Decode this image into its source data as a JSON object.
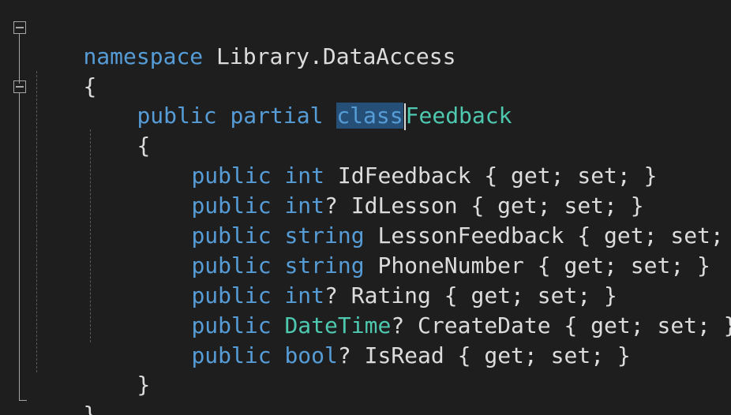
{
  "editor": {
    "language": "csharp",
    "highlighted_token": "class",
    "theme_colors": {
      "background": "#1e1e1e",
      "keyword": "#569cd6",
      "type": "#4ec9b0",
      "identifier": "#dcdcdc",
      "selection": "#264f78"
    },
    "code": {
      "namespace_kw": "namespace",
      "namespace_name": "Library.DataAccess",
      "open_brace": "{",
      "close_brace": "}",
      "class_decl": {
        "public": "public",
        "partial": "partial",
        "class": "class",
        "name": "Feedback"
      },
      "properties": [
        {
          "access": "public",
          "type": "int",
          "type_kind": "keyword",
          "nullable": "",
          "name": "IdFeedback",
          "accessors": "{ get; set; }"
        },
        {
          "access": "public",
          "type": "int",
          "type_kind": "keyword",
          "nullable": "?",
          "name": "IdLesson",
          "accessors": "{ get; set; }"
        },
        {
          "access": "public",
          "type": "string",
          "type_kind": "keyword",
          "nullable": "",
          "name": "LessonFeedback",
          "accessors": "{ get; set; }"
        },
        {
          "access": "public",
          "type": "string",
          "type_kind": "keyword",
          "nullable": "",
          "name": "PhoneNumber",
          "accessors": "{ get; set; }"
        },
        {
          "access": "public",
          "type": "int",
          "type_kind": "keyword",
          "nullable": "?",
          "name": "Rating",
          "accessors": "{ get; set; }"
        },
        {
          "access": "public",
          "type": "DateTime",
          "type_kind": "class",
          "nullable": "?",
          "name": "CreateDate",
          "accessors": "{ get; set; }"
        },
        {
          "access": "public",
          "type": "bool",
          "type_kind": "keyword",
          "nullable": "?",
          "name": "IsRead",
          "accessors": "{ get; set; }"
        }
      ]
    }
  }
}
